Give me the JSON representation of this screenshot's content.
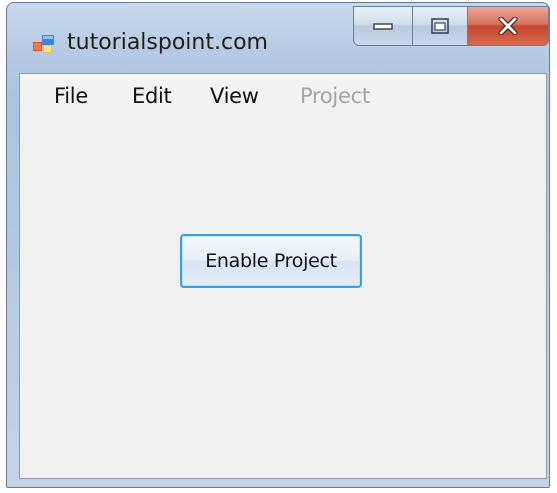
{
  "window": {
    "title": "tutorialspoint.com",
    "icon": "windows-forms-app-icon"
  },
  "caption_buttons": {
    "minimize_icon": "minimize-icon",
    "maximize_icon": "maximize-icon",
    "close_icon": "close-icon"
  },
  "menubar": {
    "items": [
      {
        "label": "File",
        "enabled": true
      },
      {
        "label": "Edit",
        "enabled": true
      },
      {
        "label": "View",
        "enabled": true
      },
      {
        "label": "Project",
        "enabled": false
      }
    ]
  },
  "main": {
    "enable_button_label": "Enable Project"
  },
  "colors": {
    "client_background": "#f0f0f0",
    "disabled_text": "#a4a4a4",
    "button_focus_border": "#3c9ed8",
    "close_button": "#c5452e"
  }
}
